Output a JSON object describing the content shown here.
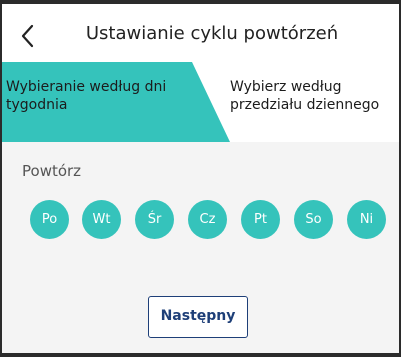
{
  "header": {
    "title": "Ustawianie cyklu powtórzeń",
    "back_icon": "chevron-left-icon"
  },
  "tabs": [
    {
      "label": "Wybieranie według dni tygodnia",
      "active": true
    },
    {
      "label": "Wybierz według przedziału dziennego",
      "active": false
    }
  ],
  "repeat": {
    "label": "Powtórz",
    "days": [
      "Po",
      "Wt",
      "Śr",
      "Cz",
      "Pt",
      "So",
      "Ni"
    ]
  },
  "next_button": {
    "label": "Następny"
  },
  "colors": {
    "accent": "#35c3bb",
    "button_border": "#1e3f78",
    "content_bg": "#f4f4f4"
  }
}
